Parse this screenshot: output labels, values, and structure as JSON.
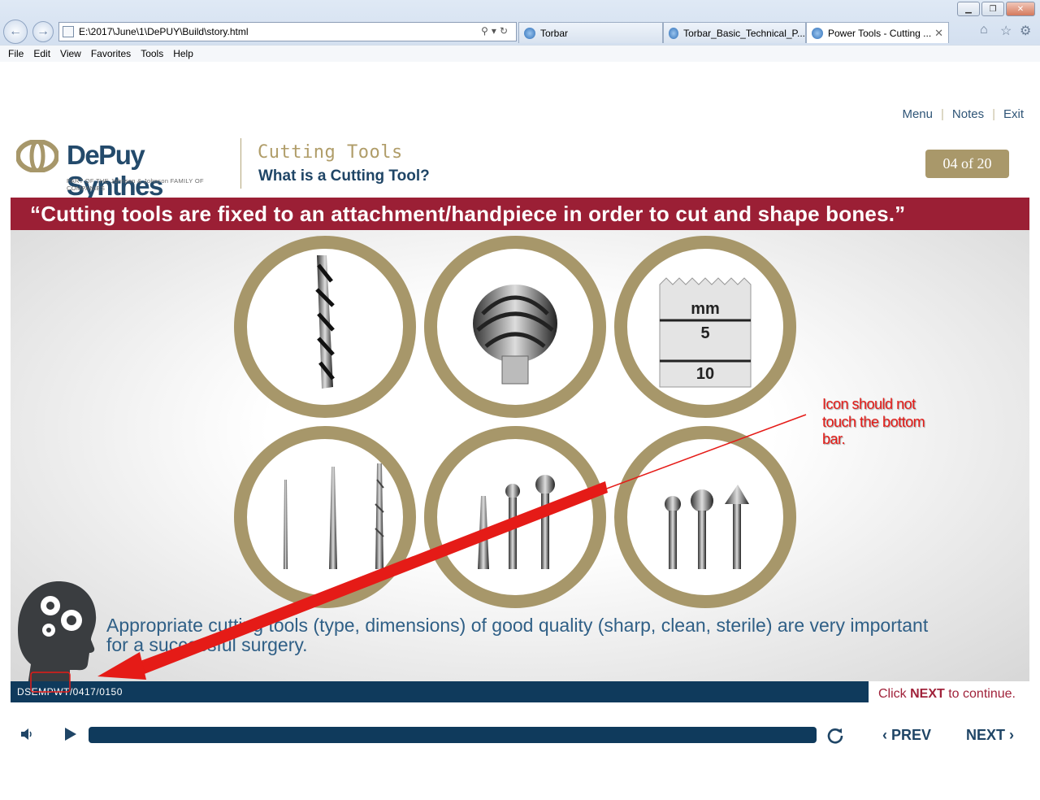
{
  "browser": {
    "address": "E:\\2017\\June\\1\\DePUY\\Build\\story.html",
    "tabs": [
      {
        "label": "Torbar"
      },
      {
        "label": "Torbar_Basic_Technical_P..."
      },
      {
        "label": "Power Tools - Cutting ..."
      }
    ],
    "menu": [
      "File",
      "Edit",
      "View",
      "Favorites",
      "Tools",
      "Help"
    ]
  },
  "course": {
    "nav": {
      "menu": "Menu",
      "notes": "Notes",
      "exit": "Exit"
    },
    "logo": {
      "name": "DePuy Synthes",
      "tagline": "PART OF THE Johnson & Johnson FAMILY OF COMPANIES"
    },
    "course_title": "Cutting Tools",
    "slide_title": "What is a Cutting Tool?",
    "pager": "04 of 20",
    "banner": "“Cutting tools are fixed to an attachment/handpiece in order to cut and shape bones.”",
    "body_line1": "Appropriate cutting tools (type, dimensions) of good quality (sharp, clean, sterile) are very important",
    "body_line2": "for a successful surgery.",
    "saw_label": {
      "unit": "mm",
      "mark1": "5",
      "mark2": "10"
    },
    "footer_code": "DSEMPWT/0417/0150",
    "next_hint": {
      "pre": "Click ",
      "strong": "NEXT",
      "post": " to continue."
    },
    "player": {
      "prev": "PREV",
      "next": "NEXT"
    },
    "colors": {
      "brand_blue": "#0f3a5c",
      "gold": "#a7976a",
      "banner_red": "#9b1f35"
    }
  },
  "annotation": {
    "line1": "Icon should not",
    "line2": "touch the bottom",
    "line3": "bar."
  }
}
